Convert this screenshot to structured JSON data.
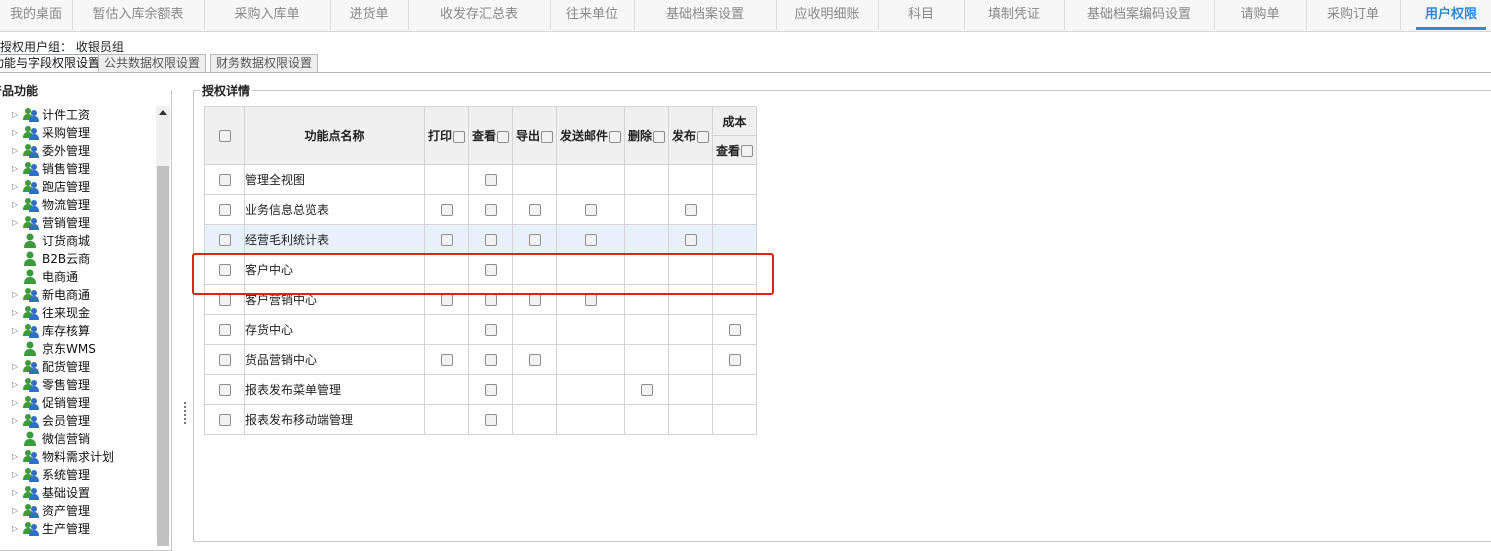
{
  "top_tabs": [
    "我的桌面",
    "暂估入库余额表",
    "采购入库单",
    "进货单",
    "收发存汇总表",
    "往来单位",
    "基础档案设置",
    "应收明细账",
    "科目",
    "填制凭证",
    "基础档案编码设置",
    "请购单",
    "采购订单",
    "用户权限"
  ],
  "active_tab_index": 13,
  "user_group": {
    "label": "授权用户组：",
    "value": "收银员组"
  },
  "sub_tabs": [
    "功能与字段权限设置",
    "公共数据权限设置",
    "财务数据权限设置"
  ],
  "left_panel": {
    "legend": "产品功能",
    "items": [
      {
        "label": "计件工资",
        "expandable": true
      },
      {
        "label": "采购管理",
        "expandable": true
      },
      {
        "label": "委外管理",
        "expandable": true
      },
      {
        "label": "销售管理",
        "expandable": true
      },
      {
        "label": "跑店管理",
        "expandable": true
      },
      {
        "label": "物流管理",
        "expandable": true
      },
      {
        "label": "营销管理",
        "expandable": true
      },
      {
        "label": "订货商城",
        "expandable": false
      },
      {
        "label": "B2B云商",
        "expandable": false
      },
      {
        "label": "电商通",
        "expandable": false
      },
      {
        "label": "新电商通",
        "expandable": true
      },
      {
        "label": "往来现金",
        "expandable": true
      },
      {
        "label": "库存核算",
        "expandable": true
      },
      {
        "label": "京东WMS",
        "expandable": false
      },
      {
        "label": "配货管理",
        "expandable": true
      },
      {
        "label": "零售管理",
        "expandable": true
      },
      {
        "label": "促销管理",
        "expandable": true
      },
      {
        "label": "会员管理",
        "expandable": true
      },
      {
        "label": "微信营销",
        "expandable": false
      },
      {
        "label": "物料需求计划",
        "expandable": true
      },
      {
        "label": "系统管理",
        "expandable": true
      },
      {
        "label": "基础设置",
        "expandable": true
      },
      {
        "label": "资产管理",
        "expandable": true
      },
      {
        "label": "生产管理",
        "expandable": true
      }
    ]
  },
  "right_panel": {
    "legend": "授权详情",
    "columns": {
      "name": "功能点名称",
      "print": "打印",
      "view": "查看",
      "export": "导出",
      "email": "发送邮件",
      "delete": "删除",
      "publish": "发布",
      "cost": "成本",
      "cost_view": "查看"
    },
    "rows": [
      {
        "name": "管理全视图",
        "print": false,
        "view": true,
        "export": false,
        "email": false,
        "delete": false,
        "publish": false,
        "cost_view": false
      },
      {
        "name": "业务信息总览表",
        "print": true,
        "view": true,
        "export": true,
        "email": true,
        "delete": false,
        "publish": true,
        "cost_view": false
      },
      {
        "name": "经营毛利统计表",
        "print": true,
        "view": true,
        "export": true,
        "email": true,
        "delete": false,
        "publish": true,
        "cost_view": false,
        "highlighted": true
      },
      {
        "name": "客户中心",
        "print": false,
        "view": true,
        "export": false,
        "email": false,
        "delete": false,
        "publish": false,
        "cost_view": false
      },
      {
        "name": "客户营销中心",
        "print": true,
        "view": true,
        "export": true,
        "email": true,
        "delete": false,
        "publish": false,
        "cost_view": false
      },
      {
        "name": "存货中心",
        "print": false,
        "view": true,
        "export": false,
        "email": false,
        "delete": false,
        "publish": false,
        "cost_view": true
      },
      {
        "name": "货品营销中心",
        "print": true,
        "view": true,
        "export": true,
        "email": false,
        "delete": false,
        "publish": false,
        "cost_view": true
      },
      {
        "name": "报表发布菜单管理",
        "print": false,
        "view": true,
        "export": false,
        "email": false,
        "delete": true,
        "publish": false,
        "cost_view": false
      },
      {
        "name": "报表发布移动端管理",
        "print": false,
        "view": true,
        "export": false,
        "email": false,
        "delete": false,
        "publish": false,
        "cost_view": false
      }
    ]
  },
  "colors": {
    "accent": "#2f88d8",
    "highlight_box": "#e0201a",
    "row_highlight": "#e8f1fb"
  }
}
